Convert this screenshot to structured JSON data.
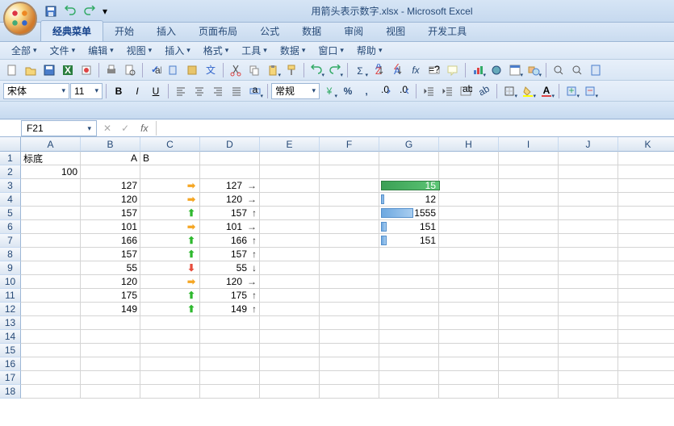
{
  "title": "用箭头表示数字.xlsx - Microsoft Excel",
  "tabs": {
    "classic": "经典菜单",
    "home": "开始",
    "insert": "插入",
    "layout": "页面布局",
    "formula": "公式",
    "data": "数据",
    "review": "审阅",
    "view": "视图",
    "dev": "开发工具"
  },
  "menus": {
    "all": "全部",
    "file": "文件",
    "edit": "编辑",
    "view": "视图",
    "insert": "插入",
    "format": "格式",
    "tools": "工具",
    "data": "数据",
    "window": "窗口",
    "help": "帮助"
  },
  "font": {
    "name": "宋体",
    "size": "11"
  },
  "number_format": "常规",
  "name_box": "F21",
  "columns": [
    "A",
    "B",
    "C",
    "D",
    "E",
    "F",
    "G",
    "H",
    "I",
    "J",
    "K"
  ],
  "rows_visible": 18,
  "grid": {
    "A1": "标底",
    "B1": "A",
    "C1": "B",
    "A2": "100",
    "B3": "127",
    "C3_arr": "right",
    "D3": "127",
    "D3_ta": "→",
    "B4": "120",
    "C4_arr": "right",
    "D4": "120",
    "D4_ta": "→",
    "B5": "157",
    "C5_arr": "up",
    "D5": "157",
    "D5_ta": "↑",
    "B6": "101",
    "C6_arr": "right",
    "D6": "101",
    "D6_ta": "→",
    "B7": "166",
    "C7_arr": "up",
    "D7": "166",
    "D7_ta": "↑",
    "B8": "157",
    "C8_arr": "up",
    "D8": "157",
    "D8_ta": "↑",
    "B9": "55",
    "C9_arr": "down",
    "D9": "55",
    "D9_ta": "↓",
    "B10": "120",
    "C10_arr": "right",
    "D10": "120",
    "D10_ta": "→",
    "B11": "175",
    "C11_arr": "up",
    "D11": "175",
    "D11_ta": "↑",
    "B12": "149",
    "C12_arr": "up",
    "D12": "149",
    "D12_ta": "↑",
    "G3": "15",
    "G3_bar": 100,
    "G3_green": true,
    "G4": "12",
    "G4_bar": 6,
    "G5": "1555",
    "G5_bar": 55,
    "G6": "151",
    "G6_bar": 10,
    "G7": "151",
    "G7_bar": 10
  },
  "icons": {}
}
